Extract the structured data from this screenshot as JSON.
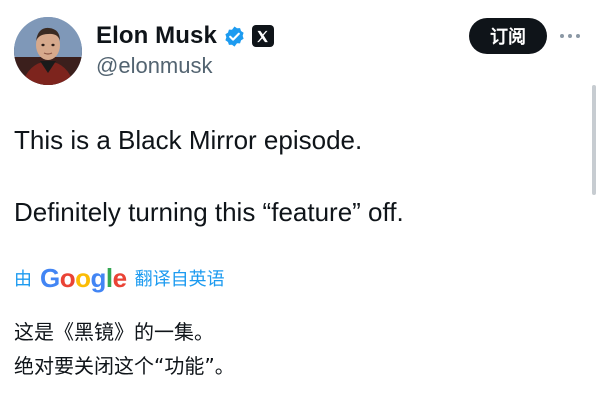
{
  "author": {
    "name": "Elon Musk",
    "handle": "@elonmusk",
    "verified_icon": "verified-badge-icon",
    "affiliate_icon": "x-logo-icon"
  },
  "actions": {
    "subscribe_label": "订阅",
    "more_icon": "more-horizontal-icon"
  },
  "tweet": {
    "lines": [
      "This is a Black Mirror episode.",
      "Definitely turning this “feature” off."
    ]
  },
  "translation": {
    "by_label": "由",
    "provider": "Google",
    "source_label": "翻译自英语",
    "lines": [
      "这是《黑镜》的一集。",
      "绝对要关闭这个“功能”。"
    ]
  },
  "colors": {
    "text": "#0f1419",
    "secondary": "#536471",
    "link": "#1d9bf0",
    "button_bg": "#0f1419"
  }
}
